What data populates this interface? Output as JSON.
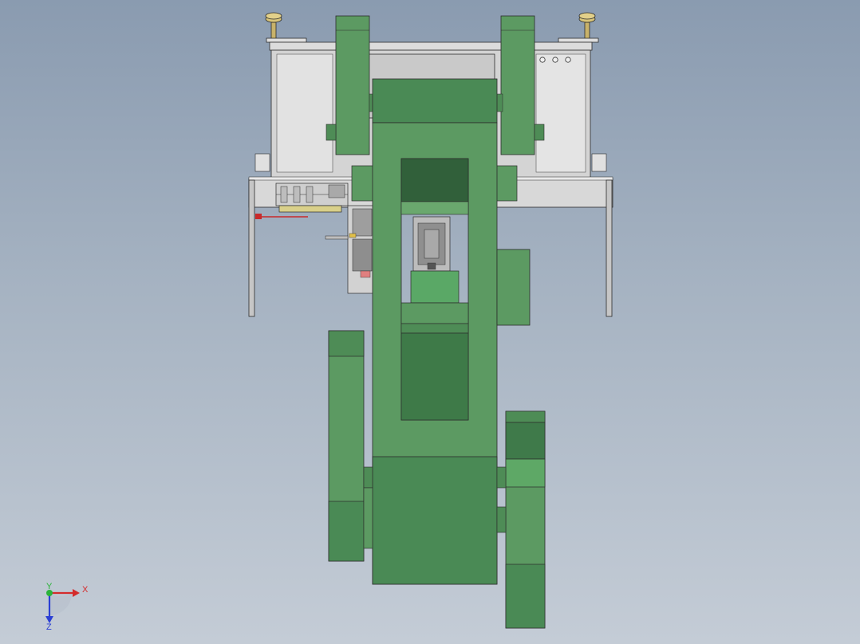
{
  "viewport": {
    "colors": {
      "background_top": "#8a9bb0",
      "background_bottom": "#c4ccd6",
      "machine_green": "#5c9a62",
      "machine_green_dark": "#3f7a4a",
      "frame_grey": "#d6d6d6",
      "outline": "#2b2b2b"
    }
  },
  "triad": {
    "x_label": "X",
    "y_label": "Y",
    "z_label": "Z",
    "x_color": "#d42b2b",
    "y_color": "#2bb33a",
    "z_color": "#2b3fd4"
  },
  "panel_holes": [
    "○",
    "○",
    "○"
  ]
}
